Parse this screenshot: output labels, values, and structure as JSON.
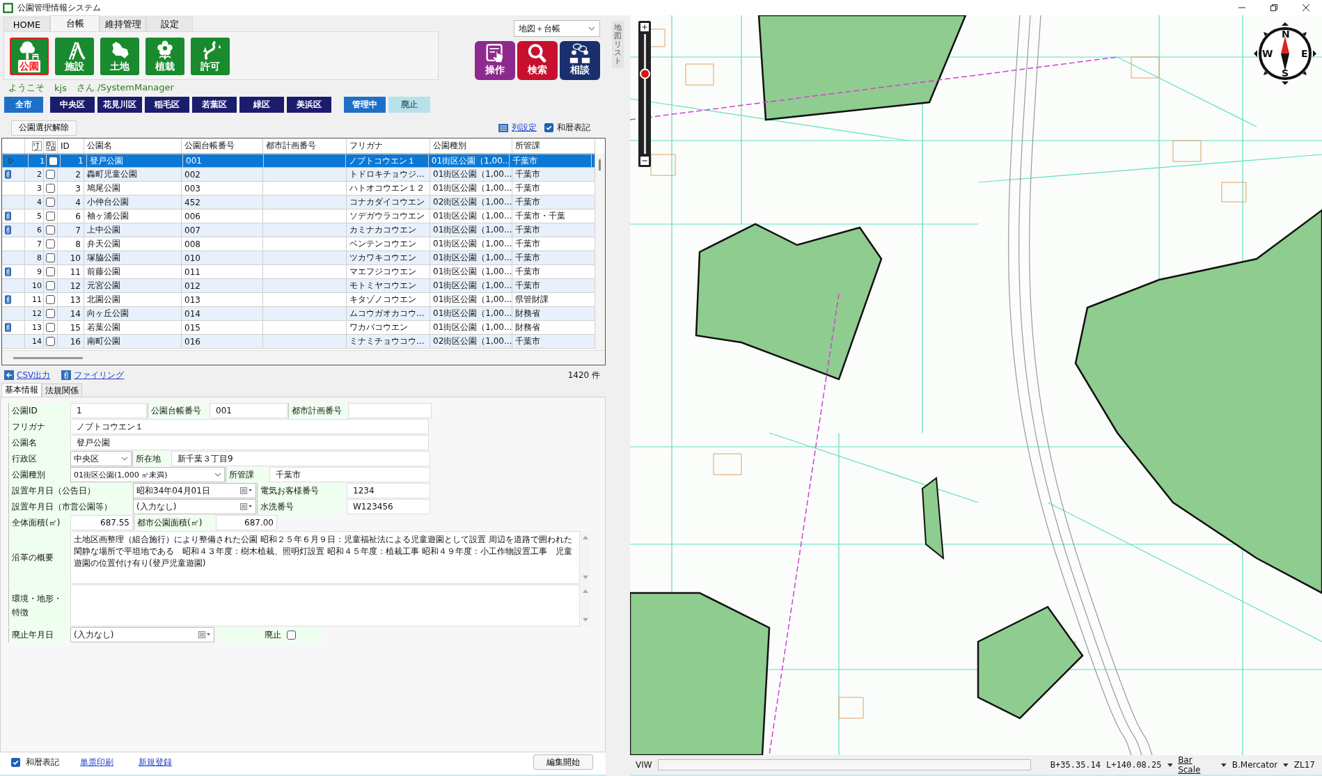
{
  "window": {
    "title": "公園管理情報システム"
  },
  "ribbon": {
    "tabs": [
      {
        "label": "HOME",
        "selected": false
      },
      {
        "label": "台帳",
        "selected": true
      },
      {
        "label": "維持管理",
        "selected": false
      },
      {
        "label": "設定",
        "selected": false
      }
    ],
    "buttons": [
      {
        "kind": "tree",
        "label": "公園",
        "selected": true
      },
      {
        "kind": "slide",
        "label": "施設",
        "selected": false
      },
      {
        "kind": "land",
        "label": "土地",
        "selected": false
      },
      {
        "kind": "flower",
        "label": "植栽",
        "selected": false
      },
      {
        "kind": "permit",
        "label": "許可",
        "selected": false
      }
    ]
  },
  "view_select": {
    "value": "地図＋台帳"
  },
  "actions": [
    {
      "kind": "operate",
      "label": "操作",
      "color": "#8e2a8e"
    },
    {
      "kind": "search",
      "label": "検索",
      "color": "#c8102e"
    },
    {
      "kind": "consult",
      "label": "相談",
      "color": "#1a2f6e"
    }
  ],
  "user": {
    "greeting": "ようこそ",
    "name": "kjs",
    "suffix": "さん /SystemManager"
  },
  "districts": [
    {
      "label": "全市",
      "selected": true
    },
    {
      "label": "中央区",
      "selected": false
    },
    {
      "label": "花見川区",
      "selected": false
    },
    {
      "label": "稲毛区",
      "selected": false
    },
    {
      "label": "若葉区",
      "selected": false
    },
    {
      "label": "緑区",
      "selected": false
    },
    {
      "label": "美浜区",
      "selected": false
    }
  ],
  "status_filters": [
    {
      "label": "管理中",
      "selected": true
    },
    {
      "label": "廃止",
      "selected": false
    }
  ],
  "clear_button": "公園選択解除",
  "column_settings": "列設定",
  "wareki": {
    "label": "和暦表記",
    "checked": true
  },
  "table": {
    "columns": [
      "ID",
      "公園名",
      "公園台帳番号",
      "都市計画番号",
      "フリガナ",
      "公園種別",
      "所管課"
    ],
    "rows": [
      {
        "no": "1",
        "id": "1",
        "name": "登戸公園",
        "ledger": "001",
        "furigana": "ノブトコウエン１",
        "type": "01街区公園（1,00...",
        "dept": "千葉市",
        "attachment": false,
        "checked": false,
        "selected": true
      },
      {
        "no": "2",
        "id": "2",
        "name": "轟町児童公園",
        "ledger": "002",
        "furigana": "トドロキチョウジ...",
        "type": "01街区公園（1,00...",
        "dept": "千葉市",
        "attachment": true,
        "checked": false,
        "selected": false
      },
      {
        "no": "3",
        "id": "3",
        "name": "鳩尾公園",
        "ledger": "003",
        "furigana": "ハトオコウエン１２",
        "type": "01街区公園（1,00...",
        "dept": "千葉市",
        "attachment": false,
        "checked": false,
        "selected": false
      },
      {
        "no": "4",
        "id": "4",
        "name": "小仲台公園",
        "ledger": "452",
        "furigana": "コナカダイコウエン",
        "type": "02街区公園（1,00...",
        "dept": "千葉市",
        "attachment": false,
        "checked": false,
        "selected": false
      },
      {
        "no": "5",
        "id": "6",
        "name": "袖ヶ浦公園",
        "ledger": "006",
        "furigana": "ソデガウラコウエン",
        "type": "01街区公園（1,00...",
        "dept": "千葉市・千葉",
        "attachment": true,
        "checked": false,
        "selected": false
      },
      {
        "no": "6",
        "id": "7",
        "name": "上中公園",
        "ledger": "007",
        "furigana": "カミナカコウエン",
        "type": "01街区公園（1,00...",
        "dept": "千葉市",
        "attachment": true,
        "checked": false,
        "selected": false
      },
      {
        "no": "7",
        "id": "8",
        "name": "弁天公園",
        "ledger": "008",
        "furigana": "ベンテンコウエン",
        "type": "01街区公園（1,00...",
        "dept": "千葉市",
        "attachment": false,
        "checked": false,
        "selected": false
      },
      {
        "no": "8",
        "id": "10",
        "name": "塚脇公園",
        "ledger": "010",
        "furigana": "ツカワキコウエン",
        "type": "01街区公園（1,00...",
        "dept": "千葉市",
        "attachment": false,
        "checked": false,
        "selected": false
      },
      {
        "no": "9",
        "id": "11",
        "name": "前藤公園",
        "ledger": "011",
        "furigana": "マエフジコウエン",
        "type": "01街区公園（1,00...",
        "dept": "千葉市",
        "attachment": true,
        "checked": false,
        "selected": false
      },
      {
        "no": "10",
        "id": "12",
        "name": "元宮公園",
        "ledger": "012",
        "furigana": "モトミヤコウエン",
        "type": "01街区公園（1,00...",
        "dept": "千葉市",
        "attachment": false,
        "checked": false,
        "selected": false
      },
      {
        "no": "11",
        "id": "13",
        "name": "北園公園",
        "ledger": "013",
        "furigana": "キタゾノコウエン",
        "type": "01街区公園（1,00...",
        "dept": "県管財課",
        "attachment": true,
        "checked": false,
        "selected": false
      },
      {
        "no": "12",
        "id": "14",
        "name": "向ヶ丘公園",
        "ledger": "014",
        "furigana": "ムコウガオカコウ...",
        "type": "01街区公園（1,00...",
        "dept": "財務省",
        "attachment": false,
        "checked": false,
        "selected": false
      },
      {
        "no": "13",
        "id": "15",
        "name": "若葉公園",
        "ledger": "015",
        "furigana": "ワカバコウエン",
        "type": "01街区公園（1,00...",
        "dept": "財務省",
        "attachment": true,
        "checked": false,
        "selected": false
      },
      {
        "no": "14",
        "id": "16",
        "name": "南町公園",
        "ledger": "016",
        "furigana": "ミナミチョウコウ...",
        "type": "02街区公園（1,00...",
        "dept": "千葉市",
        "attachment": false,
        "checked": false,
        "selected": false
      }
    ]
  },
  "export_link": "CSV出力",
  "filing_link": "ファイリング",
  "count": "1420 件",
  "form": {
    "tabs": [
      {
        "label": "基本情報",
        "selected": true
      },
      {
        "label": "法規関係",
        "selected": false
      }
    ],
    "park_id": {
      "label": "公園ID",
      "value": "1"
    },
    "ledger_no": {
      "label": "公園台帳番号",
      "value": "001"
    },
    "city_plan_no": {
      "label": "都市計画番号"
    },
    "furigana": {
      "label": "フリガナ",
      "value": "ノブトコウエン１"
    },
    "name": {
      "label": "公園名",
      "value": "登戸公園"
    },
    "ward": {
      "label": "行政区",
      "value": "中央区"
    },
    "location": {
      "label": "所在地",
      "value": "新千葉３丁目9"
    },
    "type": {
      "label": "公園種別",
      "value": "01街区公園(1,000 ㎡未満)"
    },
    "dept": {
      "label": "所管課",
      "value": "千葉市"
    },
    "notice_date": {
      "label": "設置年月日（公告日）",
      "value": "昭和34年04月01日"
    },
    "electric_no": {
      "label": "電気お客様番号",
      "value": "1234"
    },
    "city_date": {
      "label": "設置年月日（市営公園等）",
      "value": "(入力なし)"
    },
    "water_no": {
      "label": "水洗番号",
      "value": "W123456"
    },
    "total_area": {
      "label": "全体面積(㎡)",
      "value": "687.55"
    },
    "park_area": {
      "label": "都市公園面積(㎡)",
      "value": "687.00"
    },
    "history": {
      "label": "沿革の概要",
      "value": "土地区画整理（組合施行）により整備された公園 昭和２５年６月９日：児童福祉法による児童遊園として設置 周辺を道路で囲われた閑静な場所で平坦地である　昭和４３年度：樹木植栽、照明灯設置 昭和４５年度：植栽工事 昭和４９年度：小工作物設置工事　児童遊園の位置付け有り(登戸児童遊園)"
    },
    "environment": {
      "label": "環境・地形・特徴"
    },
    "abolished_date": {
      "label": "廃止年月日",
      "value": "(入力なし)"
    },
    "abolished": {
      "label": "廃止",
      "checked": false
    }
  },
  "footer": {
    "wareki": {
      "label": "和暦表記",
      "checked": true
    },
    "links": [
      "単票印刷",
      "新規登録"
    ],
    "edit_button": "編集開始"
  },
  "map_list_tab": "地図リスト",
  "map": {
    "zoom_slider": {
      "level": 0.67
    },
    "compass": {
      "n": "N",
      "e": "E",
      "s": "S",
      "w": "W"
    }
  },
  "status_bar": {
    "mode": "VIW",
    "lat": "B+35.35.14",
    "lon": "L+140.08.25",
    "scale": "Bar Scale",
    "projection": "B.Mercator",
    "zoom": "ZL17"
  }
}
